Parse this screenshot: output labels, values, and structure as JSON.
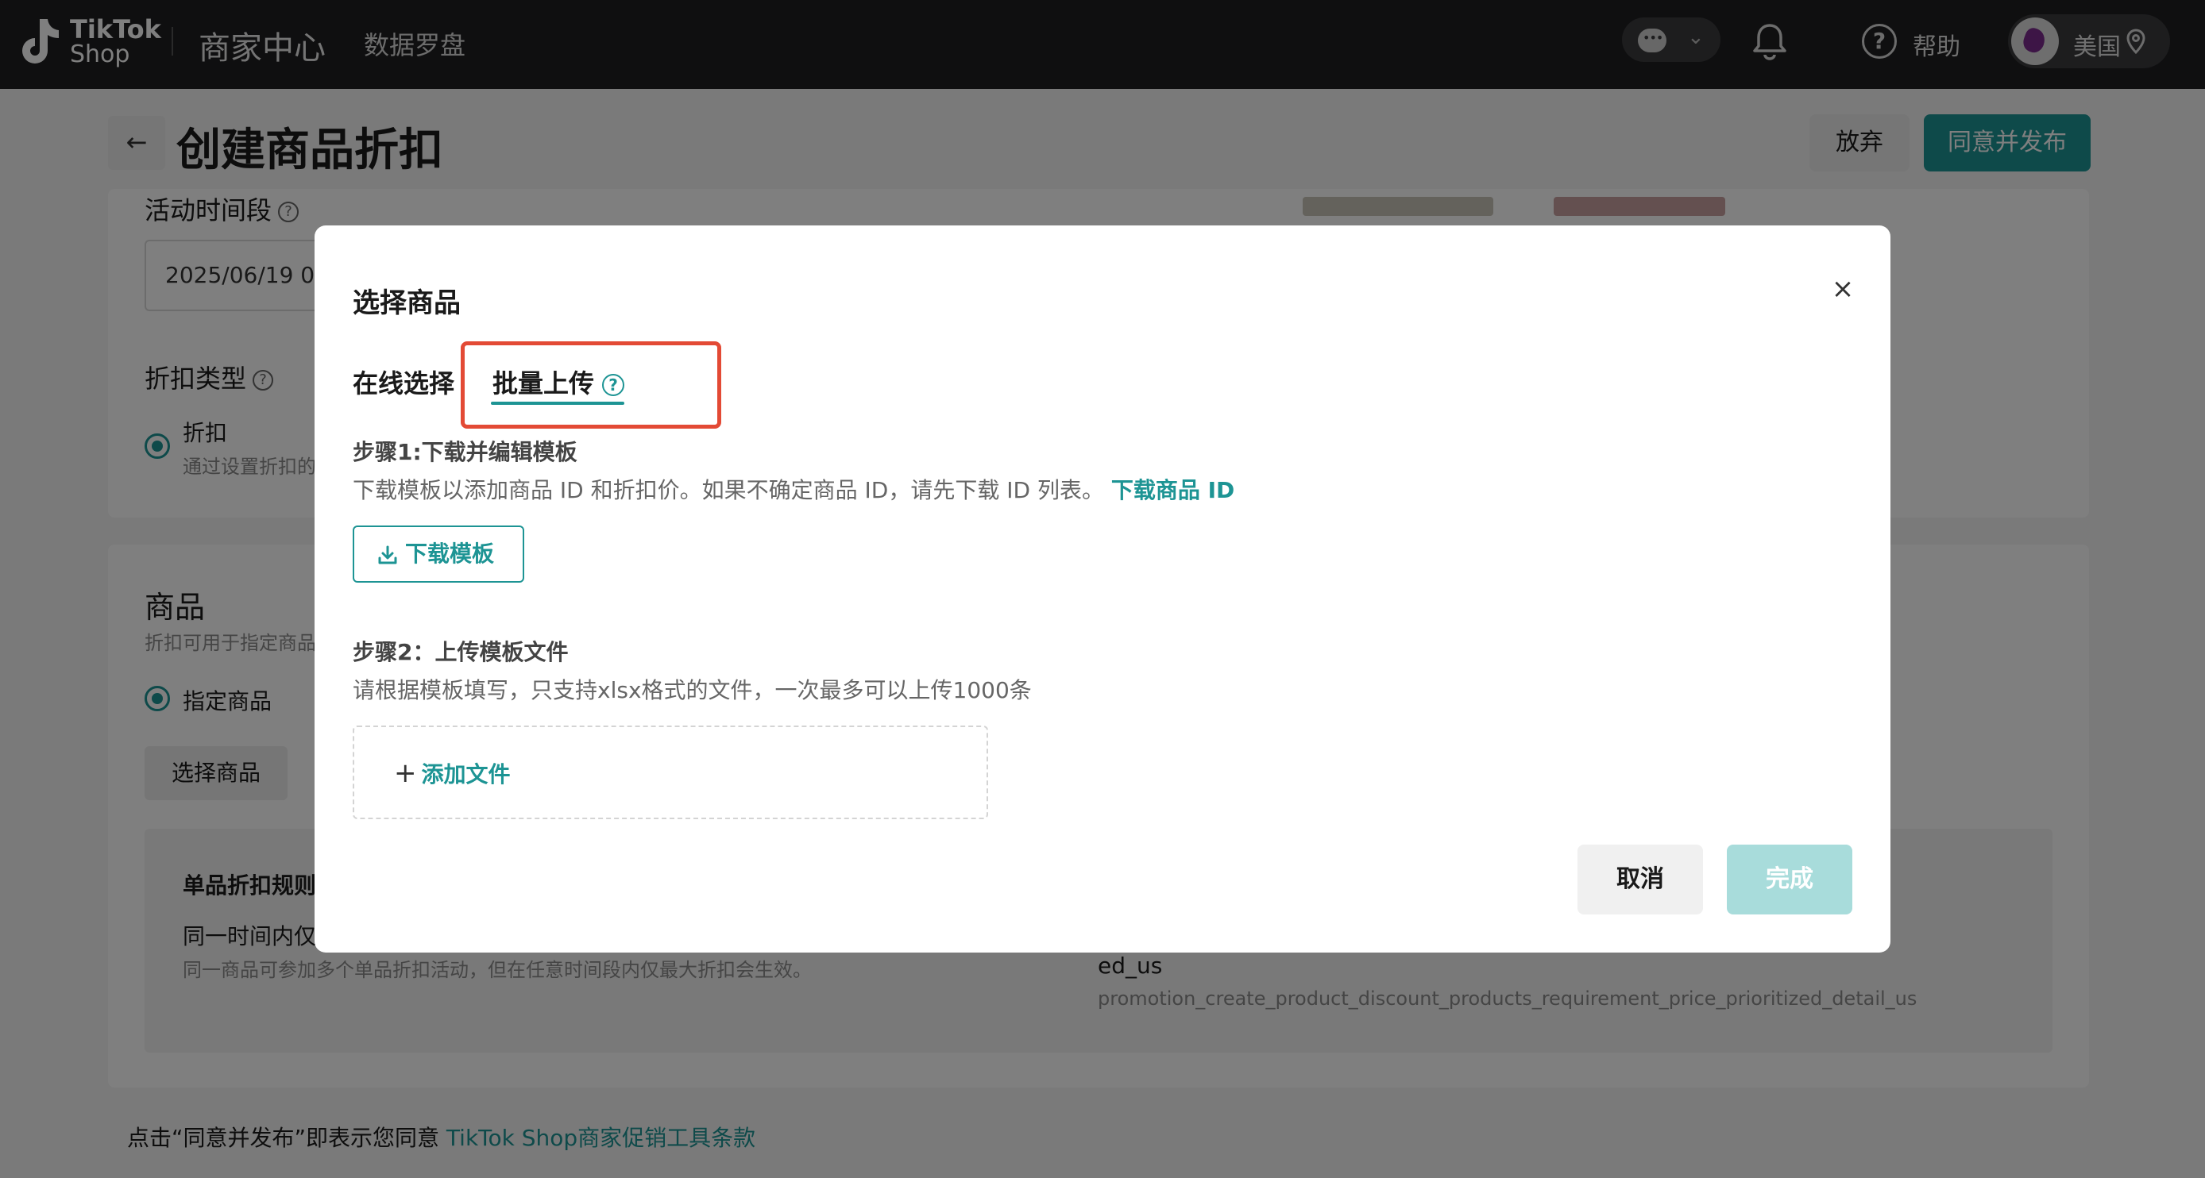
{
  "topbar": {
    "logo_line1": "TikTok",
    "logo_line2": "Shop",
    "title": "商家中心",
    "nav_item": "数据罗盘",
    "help_label": "帮助",
    "region_label": "美国"
  },
  "header": {
    "title": "创建商品折扣",
    "abandon_label": "放弃",
    "publish_label": "同意并发布"
  },
  "background": {
    "period_label": "活动时间段",
    "date_value": "2025/06/19 09",
    "discount_type_label": "折扣类型",
    "discount_option": "折扣",
    "discount_option_desc": "通过设置折扣的",
    "products_label": "商品",
    "products_desc": "折扣可用于指定商品",
    "specified_products": "指定商品",
    "select_products_button": "选择商品",
    "rule_title": "单品折扣规则",
    "rule_line": "同一时间内仅",
    "rule_desc": "同一商品可参加多个单品折扣活动，但在任意时间段内仅最大折扣会生效。",
    "rule_right_title": "ed_us",
    "rule_right_desc": "promotion_create_product_discount_products_requirement_price_prioritized_detail_us",
    "footer_note": "点击“同意并发布”即表示您同意 ",
    "footer_link": "TikTok Shop商家促销工具条款"
  },
  "modal": {
    "title": "选择商品",
    "tabs": [
      {
        "label": "在线选择"
      },
      {
        "label": "批量上传"
      }
    ],
    "step1_title": "步骤1:下载并编辑模板",
    "step1_desc": "下载模板以添加商品 ID 和折扣价。如果不确定商品 ID，请先下载 ID 列表。 ",
    "step1_link": "下载商品 ID",
    "download_button": "下载模板",
    "step2_title": "步骤2：上传模板文件",
    "step2_desc": "请根据模板填写，只支持xlsx格式的文件，一次最多可以上传1000条",
    "add_file_label": "添加文件",
    "cancel_label": "取消",
    "done_label": "完成"
  },
  "colors": {
    "brand": "#1d9494",
    "highlight": "#e34a35",
    "topbar": "#1f1f21"
  }
}
